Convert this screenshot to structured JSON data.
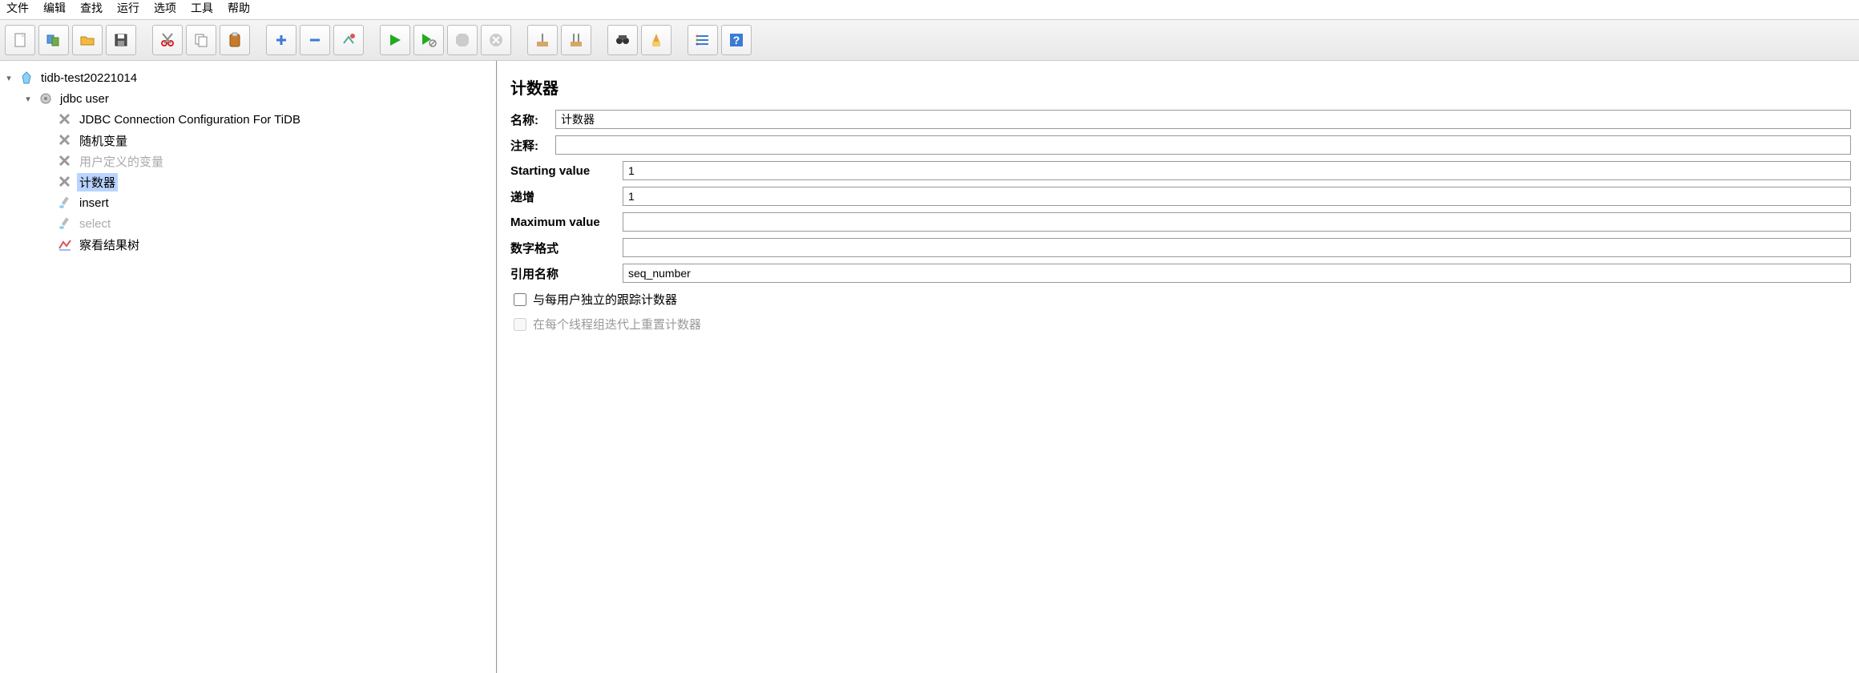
{
  "menus": {
    "file": "文件",
    "edit": "编辑",
    "search": "查找",
    "run": "运行",
    "options": "选项",
    "tools": "工具",
    "help": "帮助"
  },
  "tree": {
    "root": "tidb-test20221014",
    "tg": "jdbc user",
    "items": [
      {
        "label": "JDBC Connection Configuration For TiDB",
        "type": "config",
        "disabled": false
      },
      {
        "label": "随机变量",
        "type": "config",
        "disabled": false
      },
      {
        "label": "用户定义的变量",
        "type": "config",
        "disabled": true
      },
      {
        "label": "计数器",
        "type": "config",
        "disabled": false,
        "selected": true
      },
      {
        "label": "insert",
        "type": "sampler",
        "disabled": false
      },
      {
        "label": "select",
        "type": "sampler",
        "disabled": true
      },
      {
        "label": "察看结果树",
        "type": "listener",
        "disabled": false
      }
    ]
  },
  "editor": {
    "title": "计数器",
    "name_label": "名称:",
    "name_value": "计数器",
    "comment_label": "注释:",
    "comment_value": "",
    "start_label": "Starting value",
    "start_value": "1",
    "incr_label": "递增",
    "incr_value": "1",
    "max_label": "Maximum value",
    "max_value": "",
    "format_label": "数字格式",
    "format_value": "",
    "ref_label": "引用名称",
    "ref_value": "seq_number",
    "peruser_label": "与每用户独立的跟踪计数器",
    "reset_label": "在每个线程组迭代上重置计数器"
  }
}
